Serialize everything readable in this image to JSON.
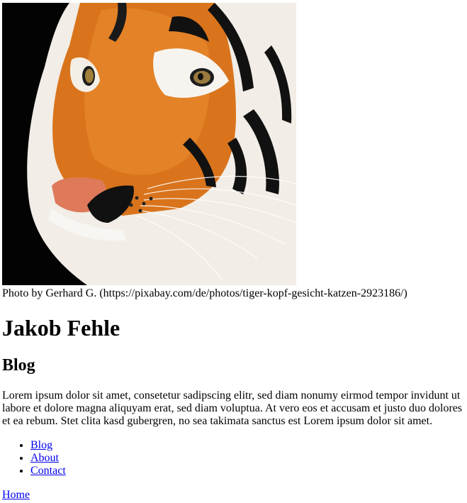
{
  "hero": {
    "subject": "tiger-face-photo",
    "credit": "Photo by Gerhard G. (https://pixabay.com/de/photos/tiger-kopf-gesicht-katzen-2923186/)"
  },
  "site": {
    "title": "Jakob Fehle"
  },
  "section": {
    "heading": "Blog",
    "body": "Lorem ipsum dolor sit amet, consetetur sadipscing elitr, sed diam nonumy eirmod tempor invidunt ut labore et dolore magna aliquyam erat, sed diam voluptua. At vero eos et accusam et justo duo dolores et ea rebum. Stet clita kasd gubergren, no sea takimata sanctus est Lorem ipsum dolor sit amet."
  },
  "nav": {
    "items": [
      {
        "label": "Blog"
      },
      {
        "label": "About"
      },
      {
        "label": "Contact"
      }
    ]
  },
  "footer": {
    "home_label": "Home"
  },
  "colors": {
    "link": "#0000ee",
    "tiger_orange": "#d9741c",
    "background_photo": "#030303"
  }
}
